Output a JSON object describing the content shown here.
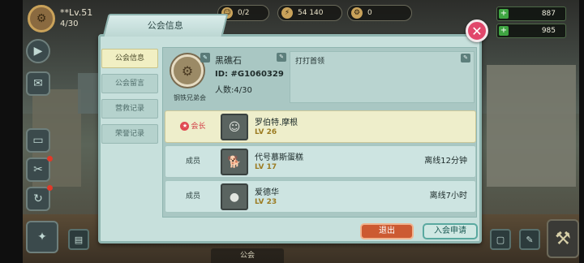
{
  "hud": {
    "player_name": "**Lv.51",
    "player_count": "4/30",
    "pill1": "0/2",
    "pill2": "54 140",
    "pill3": "0",
    "res1": "887",
    "res2": "985"
  },
  "bottom_tab": "公会",
  "dialog": {
    "title": "公会信息",
    "close": "✕",
    "tabs": [
      {
        "label": "公会信息",
        "active": true
      },
      {
        "label": "公会留言",
        "active": false
      },
      {
        "label": "营救记录",
        "active": false
      },
      {
        "label": "荣誉记录",
        "active": false
      }
    ],
    "guild": {
      "name": "黑礁石",
      "id": "ID: #G1060329",
      "members": "人数:4/30",
      "faction": "钢铁兄弟会",
      "notice": "打打首领"
    },
    "members": [
      {
        "role": "会长",
        "name": "罗伯特.摩根",
        "level": "LV 26",
        "status": "",
        "leader": true,
        "avatar": "☺"
      },
      {
        "role": "成员",
        "name": "代号慕斯蛋糕",
        "level": "LV 17",
        "status": "离线12分钟",
        "leader": false,
        "avatar": "🐕"
      },
      {
        "role": "成员",
        "name": "爱德华",
        "level": "LV 23",
        "status": "离线7小时",
        "leader": false,
        "avatar": "●"
      }
    ],
    "buttons": {
      "exit": "退出",
      "apply": "入会申请"
    }
  },
  "colors": {
    "dialog_bg": "#c7e0dc",
    "active_tab": "#f1efc3",
    "leader_row": "#eeeecb",
    "exit_button": "#cc5a32",
    "close_button": "#e1476b"
  }
}
